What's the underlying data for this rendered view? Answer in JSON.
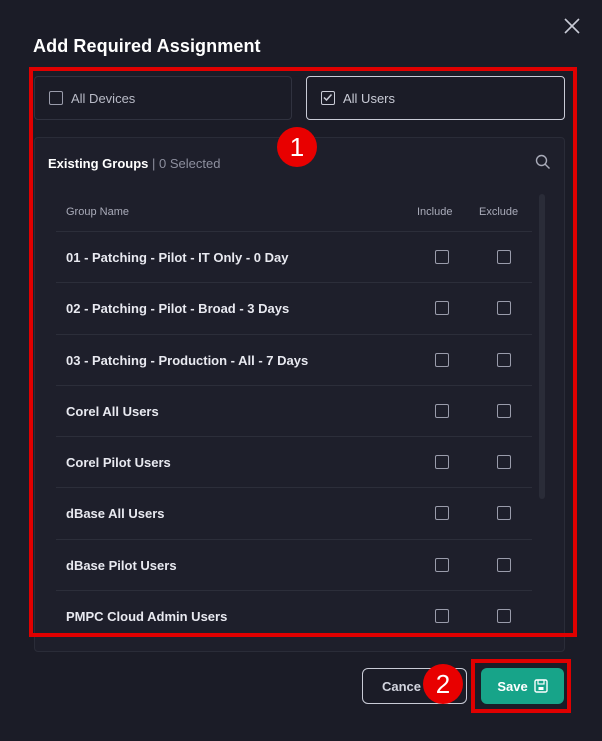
{
  "dialog": {
    "title": "Add Required Assignment"
  },
  "targets": {
    "all_devices": {
      "label": "All Devices",
      "checked": false
    },
    "all_users": {
      "label": "All Users",
      "checked": true
    }
  },
  "groups": {
    "heading": "Existing Groups",
    "selected_count": "| 0 Selected",
    "columns": {
      "name": "Group Name",
      "include": "Include",
      "exclude": "Exclude"
    },
    "rows": [
      {
        "name": "01 - Patching - Pilot - IT Only - 0 Day"
      },
      {
        "name": "02 - Patching - Pilot - Broad - 3 Days"
      },
      {
        "name": "03 - Patching - Production - All - 7 Days"
      },
      {
        "name": "Corel All Users"
      },
      {
        "name": "Corel Pilot Users"
      },
      {
        "name": "dBase All Users"
      },
      {
        "name": "dBase Pilot Users"
      },
      {
        "name": "PMPC Cloud Admin Users"
      }
    ]
  },
  "footer": {
    "cancel_label": "Cance",
    "save_label": "Save"
  },
  "annotations": {
    "badge_1": "1",
    "badge_2": "2"
  },
  "colors": {
    "background": "#1b1c27",
    "accent": "#17a489",
    "annotation": "#e00000"
  }
}
